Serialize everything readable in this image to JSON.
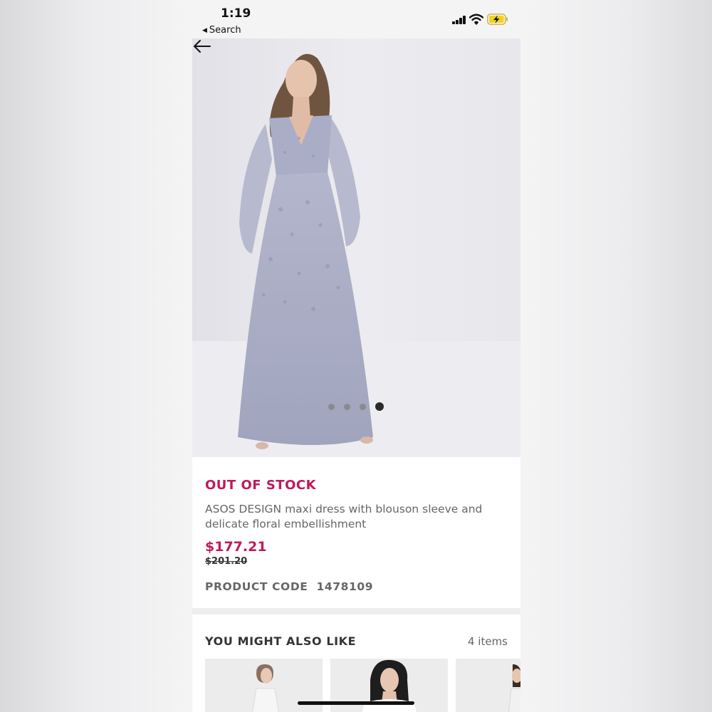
{
  "status_bar": {
    "time": "1:19",
    "back_app_label": "Search"
  },
  "hero": {
    "image_alt": "Model wearing grey-blue embellished maxi dress with blouson sleeves",
    "carousel_total": 4,
    "carousel_active": 4
  },
  "product": {
    "stock_status": "OUT OF STOCK",
    "name": "ASOS DESIGN maxi dress with blouson sleeve and delicate floral embellishment",
    "price": "$177.21",
    "original_price": "$201.20",
    "code_label": "PRODUCT CODE",
    "code_value": "1478109"
  },
  "recommendations": {
    "title": "YOU MIGHT ALSO LIKE",
    "count": "4 items"
  },
  "colors": {
    "accent": "#c2185b",
    "dress": "#a9aec6"
  }
}
